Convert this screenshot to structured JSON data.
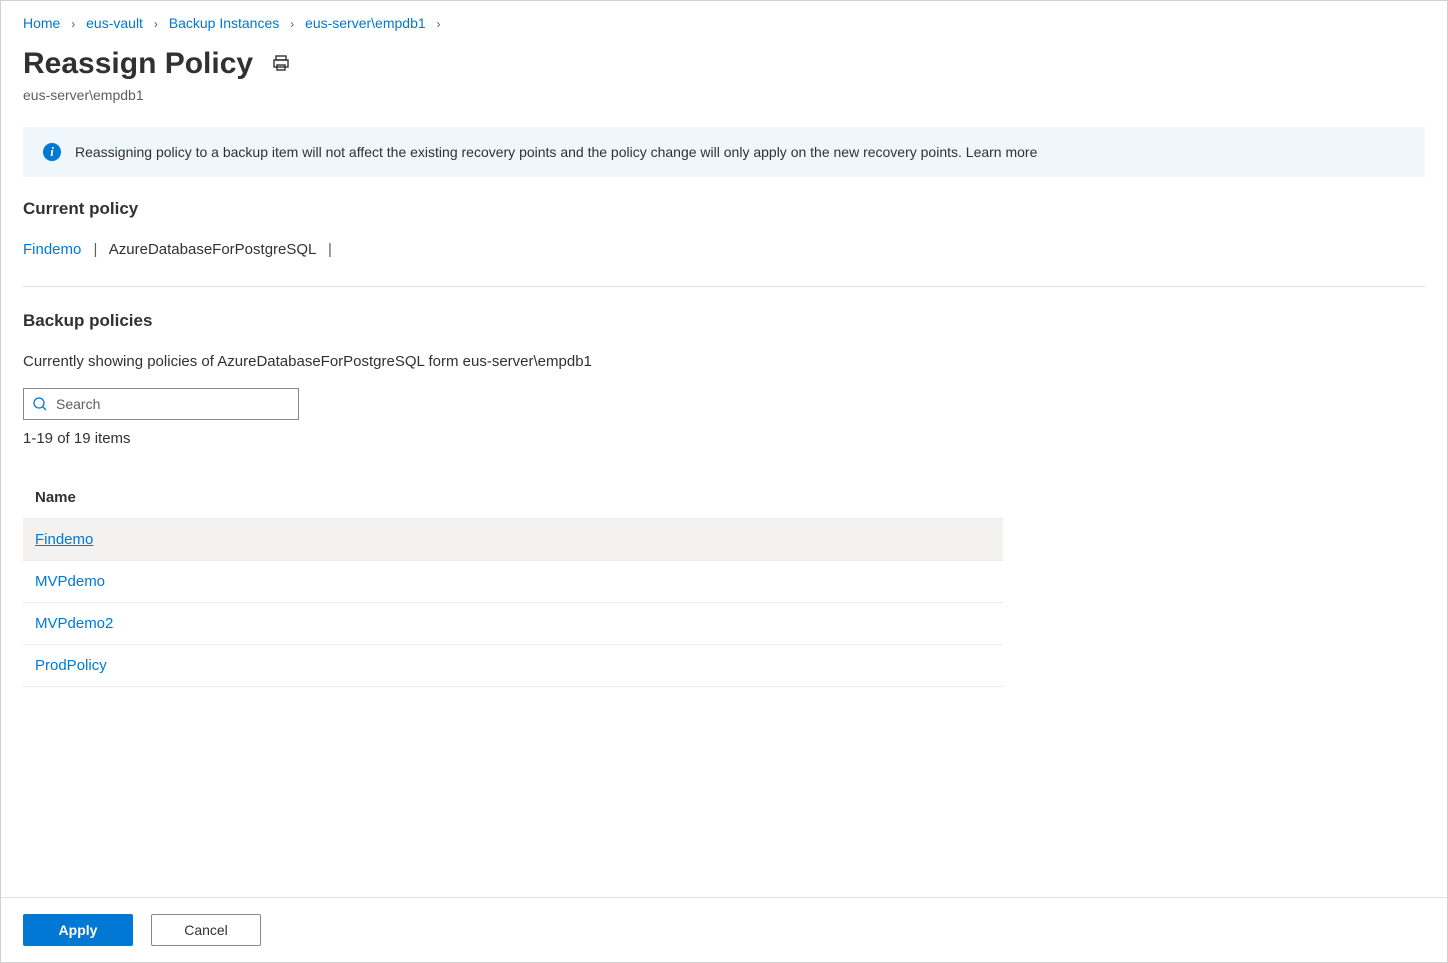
{
  "breadcrumb": [
    {
      "label": "Home"
    },
    {
      "label": "eus-vault"
    },
    {
      "label": "Backup Instances"
    },
    {
      "label": "eus-server\\empdb1"
    }
  ],
  "header": {
    "title": "Reassign Policy",
    "subtitle": "eus-server\\empdb1"
  },
  "banner": {
    "text": "Reassigning policy to a backup item will not affect the existing recovery points and the policy change will only apply on the new recovery points. Learn more"
  },
  "currentPolicy": {
    "section_title": "Current policy",
    "name": "Findemo",
    "type": "AzureDatabaseForPostgreSQL"
  },
  "backupPolicies": {
    "section_title": "Backup policies",
    "description": "Currently showing policies of AzureDatabaseForPostgreSQL form eus-server\\empdb1",
    "search_placeholder": "Search",
    "count_text": "1-19 of 19 items",
    "column_header": "Name",
    "rows": [
      {
        "name": "Findemo",
        "selected": true
      },
      {
        "name": "MVPdemo",
        "selected": false
      },
      {
        "name": "MVPdemo2",
        "selected": false
      },
      {
        "name": "ProdPolicy",
        "selected": false
      }
    ]
  },
  "footer": {
    "apply": "Apply",
    "cancel": "Cancel"
  }
}
